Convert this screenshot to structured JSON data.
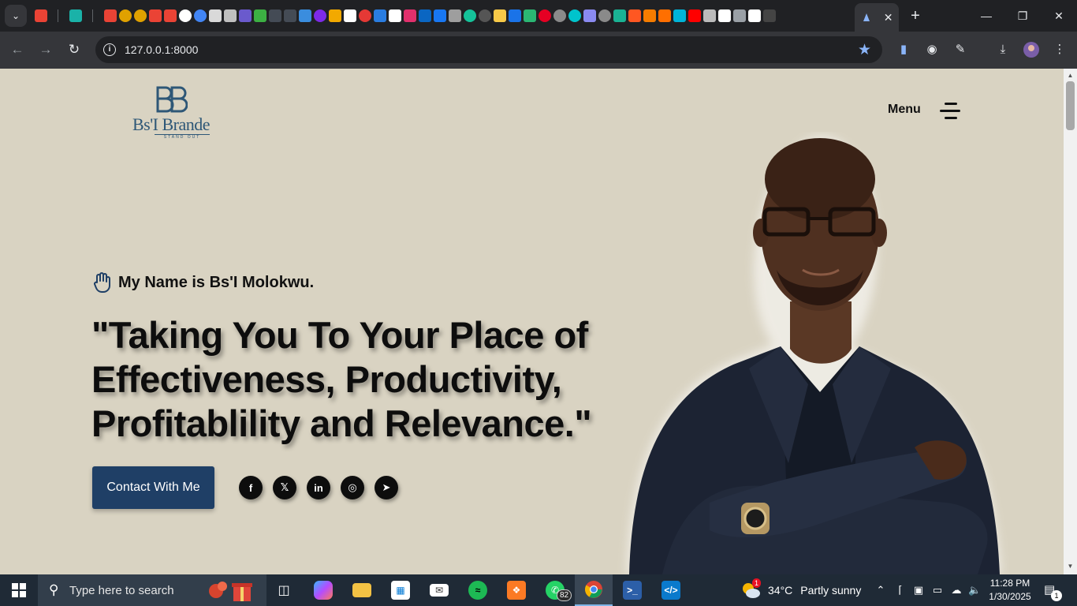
{
  "browser": {
    "url": "127.0.0.1:8000",
    "tab_close": "✕",
    "new_tab": "+",
    "pinned_favicons": [
      {
        "name": "gmail-icon",
        "color": "#ea4335"
      },
      {
        "name": "diamond-icon",
        "color": "#1ab2a8"
      },
      {
        "name": "gmail-icon",
        "color": "#ea4335"
      },
      {
        "name": "pi-icon",
        "color": "#e0a100"
      },
      {
        "name": "pi-icon",
        "color": "#e0a100"
      },
      {
        "name": "gmail-icon",
        "color": "#ea4335"
      },
      {
        "name": "gmail-icon",
        "color": "#ea4335"
      },
      {
        "name": "game-icon",
        "color": "#ffffff"
      },
      {
        "name": "google-icon",
        "color": "#4285f4"
      },
      {
        "name": "chatgpt-icon",
        "color": "#d9d9d9"
      },
      {
        "name": "wordpress-icon",
        "color": "#c0c0c0"
      },
      {
        "name": "list-icon",
        "color": "#6a5acd"
      },
      {
        "name": "hex-icon",
        "color": "#3cb043"
      },
      {
        "name": "hex-icon",
        "color": "#444b55"
      },
      {
        "name": "hex-icon",
        "color": "#444b55"
      },
      {
        "name": "arrow-icon",
        "color": "#3a8dde"
      },
      {
        "name": "canva-icon",
        "color": "#7d2ae8"
      },
      {
        "name": "star-icon",
        "color": "#f2a900"
      },
      {
        "name": "w-icon",
        "color": "#ffffff"
      },
      {
        "name": "red-dot-icon",
        "color": "#e53935"
      },
      {
        "name": "k-icon",
        "color": "#2a7de1"
      },
      {
        "name": "amazon-icon",
        "color": "#ffffff"
      },
      {
        "name": "instagram-icon",
        "color": "#e1306c"
      },
      {
        "name": "linkedin-icon",
        "color": "#0a66c2"
      },
      {
        "name": "facebook-icon",
        "color": "#1877f2"
      },
      {
        "name": "fire-icon",
        "color": "#9e9e9e"
      },
      {
        "name": "grammarly-icon",
        "color": "#15c39a"
      },
      {
        "name": "circle-icon",
        "color": "#555"
      },
      {
        "name": "badge-icon",
        "color": "#f7c948"
      },
      {
        "name": "folder-icon",
        "color": "#1a73e8"
      },
      {
        "name": "px-icon",
        "color": "#2bb673"
      },
      {
        "name": "pinterest-icon",
        "color": "#e60023"
      },
      {
        "name": "globe-icon",
        "color": "#8a8a8a"
      },
      {
        "name": "canva-icon",
        "color": "#00c4cc"
      },
      {
        "name": "calendar-icon",
        "color": "#8a8af0"
      },
      {
        "name": "globe-icon",
        "color": "#8a8a8a"
      },
      {
        "name": "m-icon",
        "color": "#1ab394"
      },
      {
        "name": "wave-icon",
        "color": "#ff5722"
      },
      {
        "name": "target-icon",
        "color": "#f57c00"
      },
      {
        "name": "dots-icon",
        "color": "#ff6f00"
      },
      {
        "name": "s-icon",
        "color": "#00b4d8"
      },
      {
        "name": "youtube-icon",
        "color": "#ff0000"
      },
      {
        "name": "mask-icon",
        "color": "#bbbbbb"
      },
      {
        "name": "x-icon",
        "color": "#ffffff"
      },
      {
        "name": "grid-icon",
        "color": "#9aa0a6"
      },
      {
        "name": "doc-icon",
        "color": "#ffffff"
      },
      {
        "name": "terminal-icon",
        "color": "#444"
      }
    ],
    "toolbar_icons": [
      "bookmark-icon",
      "extension-icon",
      "puzzle-icon",
      "download-icon",
      "profile-icon",
      "more-icon"
    ]
  },
  "site": {
    "logo": {
      "mark": "BB",
      "name": "Bs'I Brande",
      "tagline": "STAND OUT"
    },
    "menu_label": "Menu",
    "intro": "My Name is Bs'I Molokwu.",
    "headline": "\"Taking You To Your Place of Effectiveness, Productivity, Profitablility and Relevance.\"",
    "contact_button": "Contact With Me",
    "socials": [
      {
        "name": "facebook-icon",
        "glyph": "f"
      },
      {
        "name": "x-twitter-icon",
        "glyph": "𝕏"
      },
      {
        "name": "linkedin-icon",
        "glyph": "in"
      },
      {
        "name": "instagram-icon",
        "glyph": "◎"
      },
      {
        "name": "telegram-icon",
        "glyph": "➤"
      }
    ],
    "colors": {
      "background": "#d9d3c2",
      "brand_blue": "#2e5777",
      "button_blue": "#1f3f66"
    }
  },
  "taskbar": {
    "search_placeholder": "Type here to search",
    "whatsapp_badge": "82",
    "weather_alert": "1",
    "temperature": "34°C",
    "weather": "Partly sunny",
    "time": "11:28 PM",
    "date": "1/30/2025",
    "notifications": "1",
    "apps": [
      "task-view-icon",
      "copilot-icon",
      "file-explorer-icon",
      "store-icon",
      "mail-icon",
      "spotify-icon",
      "xampp-icon",
      "whatsapp-icon",
      "chrome-icon",
      "powershell-icon",
      "vscode-icon"
    ]
  }
}
